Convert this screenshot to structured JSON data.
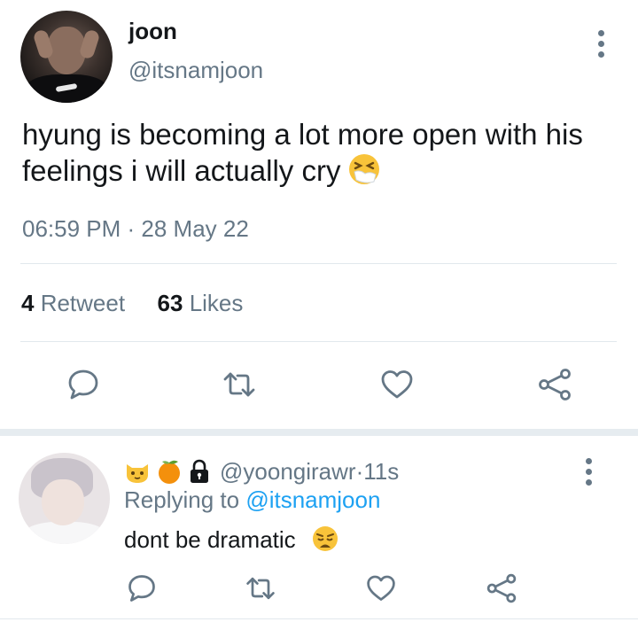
{
  "tweet": {
    "author_name": "joon",
    "author_handle": "@itsnamjoon",
    "text": "hyung is becoming a lot more open with his feelings i will actually cry",
    "text_emoji": "sneezing-face-emoji",
    "time": "06:59 PM",
    "separator": " · ",
    "date": "28 May 22",
    "retweet_count": "4",
    "retweet_label": " Retweet",
    "likes_count": "63",
    "likes_label": " Likes"
  },
  "actions": {
    "icons": [
      "reply-icon",
      "retweet-icon",
      "like-icon",
      "share-icon"
    ]
  },
  "reply": {
    "name_emojis": [
      "cat-face-emoji",
      "tangerine-emoji",
      "lock-icon"
    ],
    "handle": "@yoongirawr",
    "time_separator": " · ",
    "time": "11s",
    "replying_prefix": "Replying to ",
    "replying_to": "@itsnamjoon",
    "text": "dont be dramatic",
    "text_emoji": "weary-face-emoji"
  },
  "colors": {
    "text_primary": "#14171a",
    "text_secondary": "#657786",
    "link": "#1da1f2",
    "divider": "#e1e8ed",
    "section_gap": "#e6ecf0"
  }
}
